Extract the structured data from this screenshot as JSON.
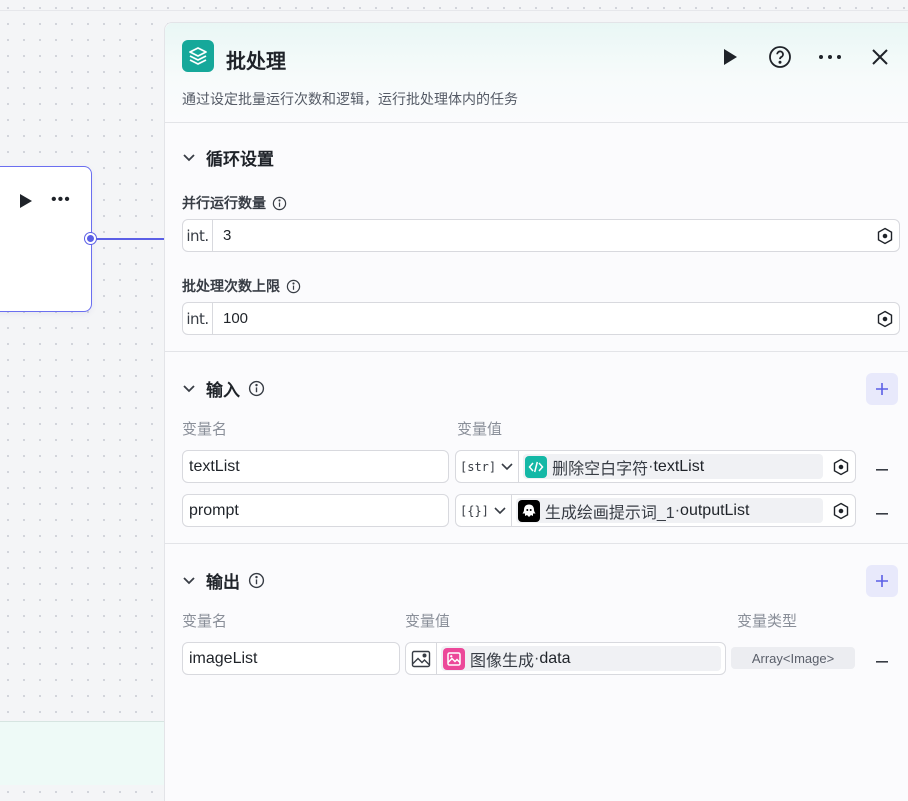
{
  "panel": {
    "title": "批处理",
    "description": "通过设定批量运行次数和逻辑，运行批处理体内的任务"
  },
  "loop_settings": {
    "title": "循环设置",
    "concurrency": {
      "label": "并行运行数量",
      "type_tag": "int.",
      "value": "3"
    },
    "max_batch": {
      "label": "批处理次数上限",
      "type_tag": "int.",
      "value": "100"
    }
  },
  "inputs": {
    "title": "输入",
    "col_name": "变量名",
    "col_value": "变量值",
    "rows": [
      {
        "name": "textList",
        "type_tag": "[str]",
        "node": "删除空白字符",
        "separator": " · ",
        "var": "textList"
      },
      {
        "name": "prompt",
        "type_tag": "[{}]",
        "node": "生成绘画提示词_1",
        "separator": " · ",
        "var": "outputList"
      }
    ]
  },
  "outputs": {
    "title": "输出",
    "col_name": "变量名",
    "col_value": "变量值",
    "col_type": "变量类型",
    "rows": [
      {
        "name": "imageList",
        "node": "图像生成",
        "separator": " · ",
        "var": "data",
        "type": "Array<Image>"
      }
    ]
  },
  "colors": {
    "accent": "#5b5fe6",
    "batch_icon": "#16a89a",
    "code_node": "#14b8a6",
    "llm_node": "#000000",
    "image_node": "#ec4899"
  }
}
